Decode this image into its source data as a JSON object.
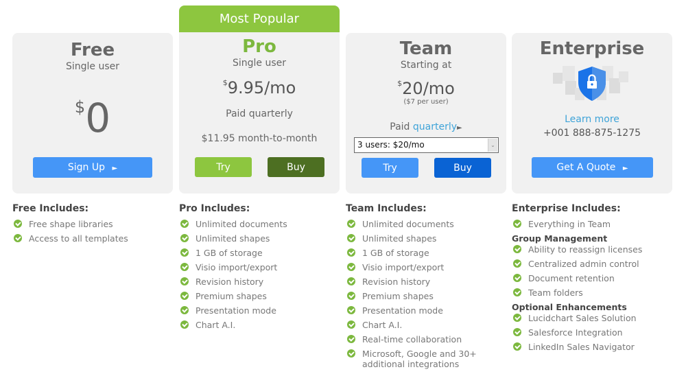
{
  "plans": {
    "free": {
      "name": "Free",
      "subtitle": "Single user",
      "currency": "$",
      "price": "0",
      "cta": "Sign Up",
      "cta_icon": "►",
      "includes_title": "Free Includes:",
      "features": [
        "Free shape libraries",
        "Access to all templates"
      ]
    },
    "pro": {
      "banner": "Most Popular",
      "name": "Pro",
      "subtitle": "Single user",
      "currency": "$",
      "price": "9.95/mo",
      "billing": "Paid quarterly",
      "monthly": "$11.95 month-to-month",
      "try_label": "Try",
      "buy_label": "Buy",
      "includes_title": "Pro Includes:",
      "features": [
        "Unlimited documents",
        "Unlimited shapes",
        "1 GB of storage",
        "Visio import/export",
        "Revision history",
        "Premium shapes",
        "Presentation mode",
        "Chart A.I."
      ]
    },
    "team": {
      "name": "Team",
      "subtitle": "Starting at",
      "currency": "$",
      "price": "20/mo",
      "per_user": "($7 per user)",
      "billing_prefix": "Paid",
      "billing_link": "quarterly",
      "billing_icon": "►",
      "select_value": "3 users: $20/mo",
      "select_arrow": "⌄",
      "try_label": "Try",
      "buy_label": "Buy",
      "includes_title": "Team Includes:",
      "features": [
        "Unlimited documents",
        "Unlimited shapes",
        "1 GB of storage",
        "Visio import/export",
        "Revision history",
        "Premium shapes",
        "Presentation mode",
        "Chart A.I.",
        "Real-time collaboration",
        "Microsoft, Google and 30+ additional integrations"
      ]
    },
    "enterprise": {
      "name": "Enterprise",
      "learn_more": "Learn more",
      "phone": "+001 888-875-1275",
      "cta": "Get A Quote",
      "cta_icon": "►",
      "includes_title": "Enterprise Includes:",
      "features": [
        "Everything in Team"
      ],
      "group_title": "Group Management",
      "group_features": [
        "Ability to reassign licenses",
        "Centralized admin control",
        "Document retention",
        "Team folders"
      ],
      "optional_title": "Optional Enhancements",
      "optional_features": [
        "Lucidchart Sales Solution",
        "Salesforce Integration",
        "LinkedIn Sales Navigator"
      ]
    }
  },
  "colors": {
    "brand_green": "#8dc63f",
    "dark_green": "#4d6f22",
    "blue": "#4596f7",
    "dark_blue": "#0a63d4",
    "link": "#3ea3d8"
  }
}
